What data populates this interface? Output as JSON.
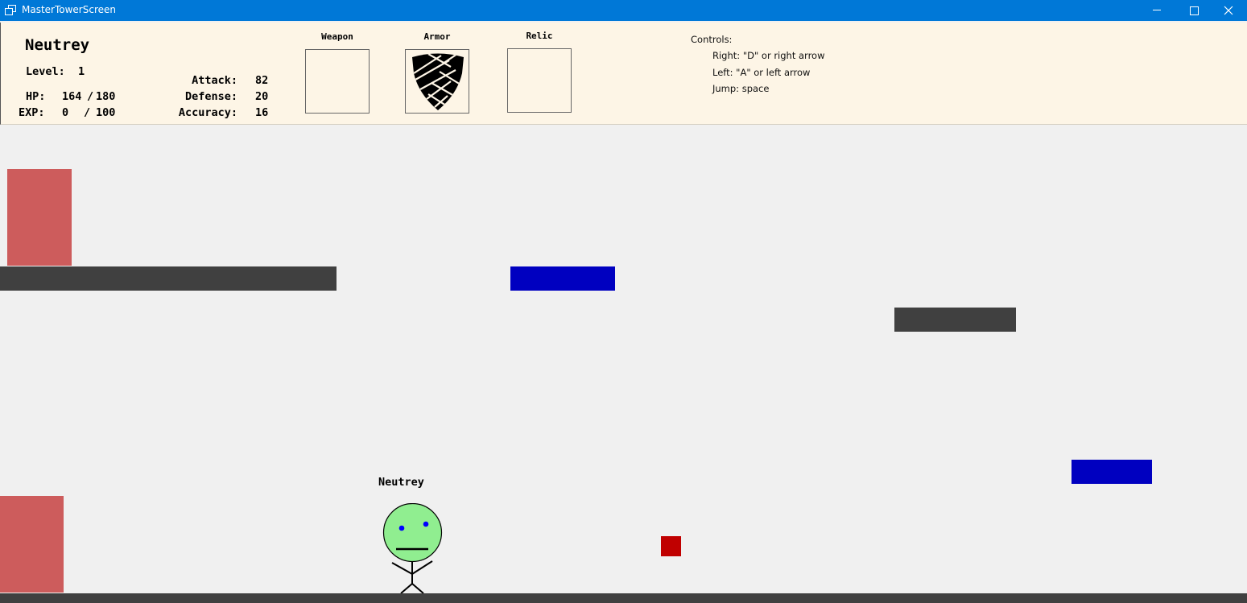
{
  "window": {
    "title": "MasterTowerScreen",
    "icons": {
      "app": "app-window-icon",
      "minimize": "minimize-icon",
      "maximize": "maximize-icon",
      "close": "close-icon"
    },
    "accent_color": "#0078d7"
  },
  "player": {
    "name": "Neutrey",
    "level_label": "Level:",
    "level": "1",
    "hp_label": "HP:",
    "hp_current": "164",
    "hp_sep": "/",
    "hp_max": "180",
    "exp_label": "EXP:",
    "exp_current": "0",
    "exp_sep": "/",
    "exp_max": "100",
    "attack_label": "Attack:",
    "attack": "82",
    "defense_label": "Defense:",
    "defense": "20",
    "accuracy_label": "Accuracy:",
    "accuracy": "16"
  },
  "equipment": {
    "weapon": {
      "label": "Weapon",
      "item_icon": ""
    },
    "armor": {
      "label": "Armor",
      "item_icon": "shield-icon"
    },
    "relic": {
      "label": "Relic",
      "item_icon": ""
    }
  },
  "controls": {
    "title": "Controls:",
    "right": "Right: \"D\" or right arrow",
    "left": "Left: \"A\" or left arrow",
    "jump": "Jump: space"
  },
  "world": {
    "avatar_name": "Neutrey",
    "avatar_icon": "stick-figure-player-icon",
    "colors": {
      "background": "#f0f0f0",
      "platform_gray": "#404040",
      "platform_blue": "#0000c0",
      "door_red": "#cd5c5c",
      "item_red": "#c00000",
      "avatar_face": "#90ee90",
      "avatar_eyes": "#0000ff"
    }
  }
}
